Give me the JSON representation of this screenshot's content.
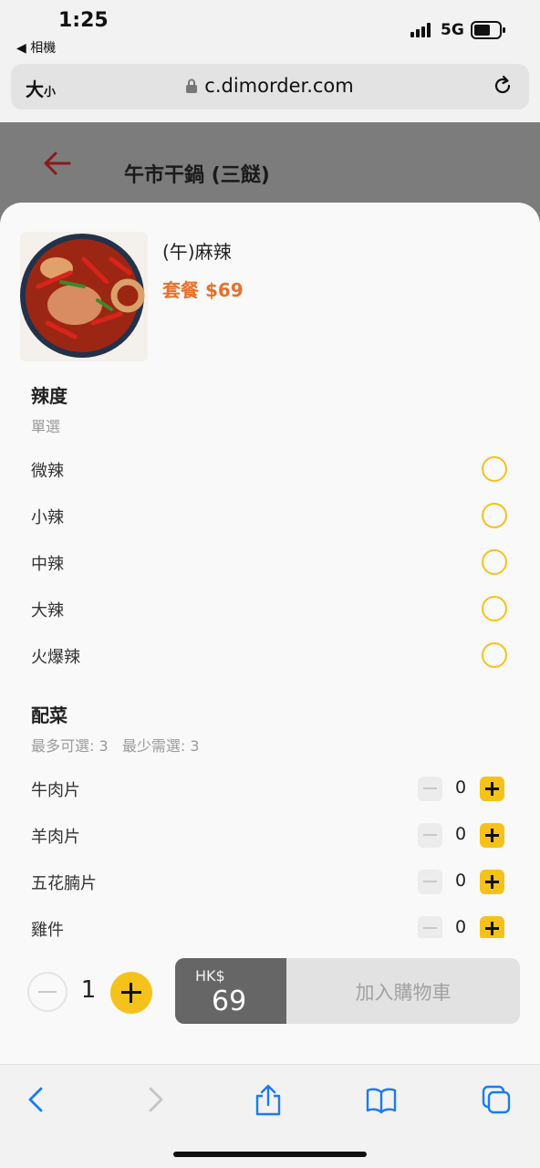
{
  "status_bar": {
    "time": "1:25",
    "back_app": "◀ 相機",
    "network": "5G"
  },
  "address_bar": {
    "text_size_big": "大",
    "text_size_small": "小",
    "url": "c.dimorder.com"
  },
  "header": {
    "title": "午市干鍋 (三餸)"
  },
  "dish": {
    "name": "(午)麻辣",
    "price": "套餐 $69"
  },
  "spice": {
    "title": "辣度",
    "subtitle": "單選",
    "options": [
      "微辣",
      "小辣",
      "中辣",
      "大辣",
      "火爆辣"
    ]
  },
  "sides": {
    "title": "配菜",
    "subtitle": "最多可選: 3   最少需選: 3",
    "items": [
      {
        "label": "牛肉片",
        "count": "0"
      },
      {
        "label": "羊肉片",
        "count": "0"
      },
      {
        "label": "五花腩片",
        "count": "0"
      },
      {
        "label": "雞件",
        "count": "0"
      }
    ]
  },
  "order": {
    "quantity": "1",
    "currency": "HK$",
    "total": "69",
    "add_label": "加入購物車"
  },
  "colors": {
    "accent": "#f5c21b",
    "price": "#e8702a",
    "back_arrow": "#8b1a1a"
  }
}
